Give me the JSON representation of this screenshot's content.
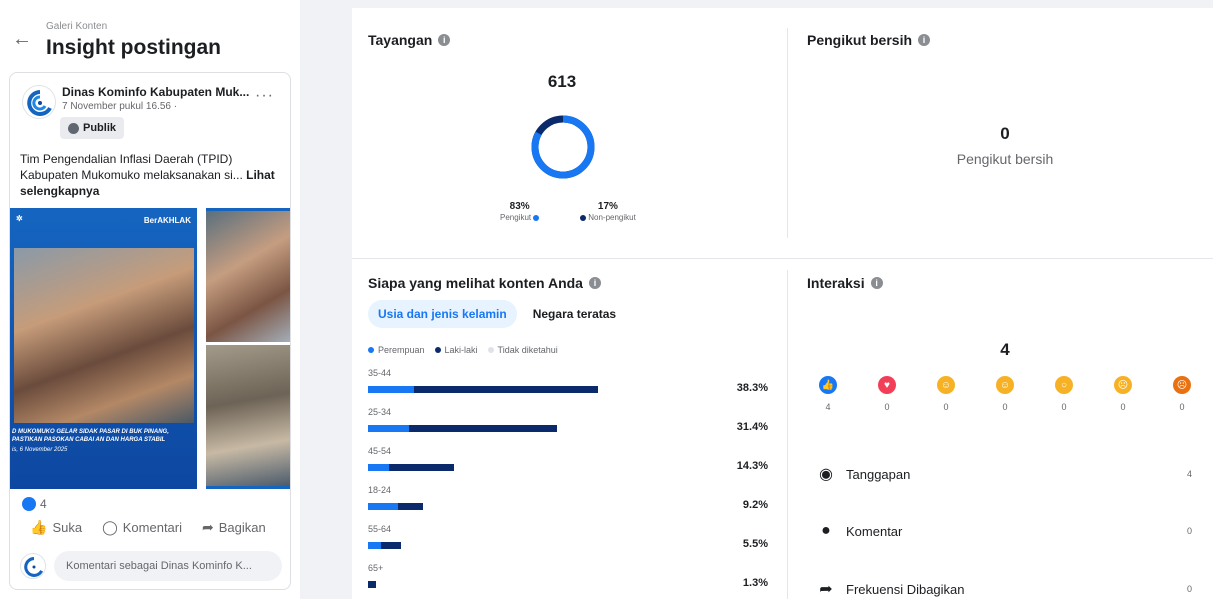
{
  "header": {
    "breadcrumb": "Galeri Konten",
    "title": "Insight postingan"
  },
  "post": {
    "author": "Dinas Kominfo Kabupaten Muk...",
    "date": "7 November pukul 16.56 ·",
    "privacy": "Publik",
    "caption": "Tim Pengendalian Inflasi Daerah (TPID) Kabupaten Mukomuko melaksanakan si...",
    "see_more": "Lihat selengkapnya",
    "image_badge_right": "BerAKHLAK",
    "image_caption": "D MUKOMUKO GELAR SIDAK PASAR DI BUK PINANG, PASTIKAN PASOKAN CABAI AN DAN HARGA STABIL",
    "image_date": "is, 6 November 2025",
    "like_count": "4",
    "actions": {
      "like": "Suka",
      "comment": "Komentari",
      "share": "Bagikan"
    },
    "comment_placeholder": "Komentari sebagai Dinas Kominfo K..."
  },
  "views": {
    "title": "Tayangan",
    "total": "613",
    "followers_pct": "83%",
    "followers_label": "Pengikut",
    "nonfollowers_pct": "17%",
    "nonfollowers_label": "Non-pengikut",
    "followers_fraction": 0.83
  },
  "net_followers": {
    "title": "Pengikut bersih",
    "value": "0",
    "label": "Pengikut bersih"
  },
  "audience": {
    "title": "Siapa yang melihat konten Anda",
    "tabs": [
      "Usia dan jenis kelamin",
      "Negara teratas"
    ],
    "active_tab": 0,
    "legend": [
      "Perempuan",
      "Laki-laki",
      "Tidak diketahui"
    ],
    "colors": {
      "female": "#1877f2",
      "male": "#0b2a6b",
      "unknown": "#dfe3e8"
    },
    "rows": [
      {
        "age": "35-44",
        "pct": "38.3%",
        "value": 38.3,
        "female_share": 0.2
      },
      {
        "age": "25-34",
        "pct": "31.4%",
        "value": 31.4,
        "female_share": 0.22
      },
      {
        "age": "45-54",
        "pct": "14.3%",
        "value": 14.3,
        "female_share": 0.25
      },
      {
        "age": "18-24",
        "pct": "9.2%",
        "value": 9.2,
        "female_share": 0.55
      },
      {
        "age": "55-64",
        "pct": "5.5%",
        "value": 5.5,
        "female_share": 0.4
      },
      {
        "age": "65+",
        "pct": "1.3%",
        "value": 1.3,
        "female_share": 0
      }
    ]
  },
  "interactions": {
    "title": "Interaksi",
    "total": "4",
    "reactions": [
      {
        "name": "like",
        "count": "4",
        "color": "#1877f2",
        "glyph": "👍"
      },
      {
        "name": "love",
        "count": "0",
        "color": "#f33e58",
        "glyph": "♥"
      },
      {
        "name": "care",
        "count": "0",
        "color": "#f7b125",
        "glyph": "☺"
      },
      {
        "name": "haha",
        "count": "0",
        "color": "#f7b125",
        "glyph": "☺"
      },
      {
        "name": "wow",
        "count": "0",
        "color": "#f7b125",
        "glyph": "○"
      },
      {
        "name": "sad",
        "count": "0",
        "color": "#f7b125",
        "glyph": "☹"
      },
      {
        "name": "angry",
        "count": "0",
        "color": "#e9710f",
        "glyph": "☹"
      }
    ],
    "rows": [
      {
        "label": "Tanggapan",
        "value": "4",
        "icon": "reactions-icon"
      },
      {
        "label": "Komentar",
        "value": "0",
        "icon": "comment-icon"
      },
      {
        "label": "Frekuensi Dibagikan",
        "value": "0",
        "icon": "share-icon"
      }
    ]
  }
}
